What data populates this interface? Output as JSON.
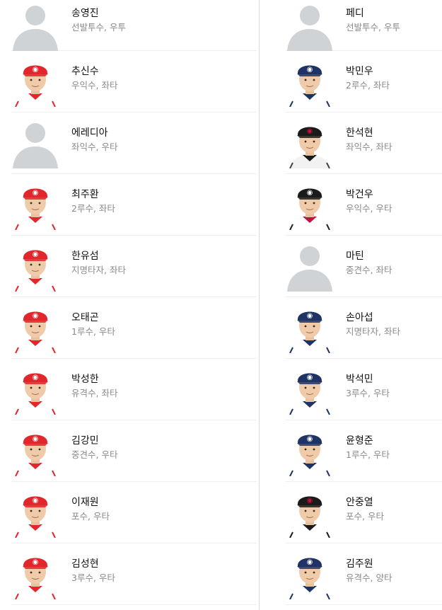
{
  "colors": {
    "ssg": "#e1262c",
    "nc": "#1f3464",
    "lg": "#c1123b",
    "kt": "#1b1b1b",
    "lotte": "#2a3556",
    "placeholder": "#cfd3d6"
  },
  "left_players": [
    {
      "name": "송영진",
      "detail": "선발투수, 우투",
      "photo": "placeholder-icon"
    },
    {
      "name": "추신수",
      "detail": "우익수, 좌타",
      "photo": "ssg-cap"
    },
    {
      "name": "에레디아",
      "detail": "좌익수, 우타",
      "photo": "placeholder-icon"
    },
    {
      "name": "최주환",
      "detail": "2루수, 좌타",
      "photo": "ssg-cap"
    },
    {
      "name": "한유섬",
      "detail": "지명타자, 좌타",
      "photo": "ssg-cap"
    },
    {
      "name": "오태곤",
      "detail": "1루수, 우타",
      "photo": "ssg-cap"
    },
    {
      "name": "박성한",
      "detail": "유격수, 좌타",
      "photo": "ssg-cap"
    },
    {
      "name": "김강민",
      "detail": "중견수, 우타",
      "photo": "ssg-cap"
    },
    {
      "name": "이재원",
      "detail": "포수, 우타",
      "photo": "ssg-cap"
    },
    {
      "name": "김성현",
      "detail": "3루수, 우타",
      "photo": "ssg-cap"
    }
  ],
  "right_players": [
    {
      "name": "페디",
      "detail": "선발투수, 우투",
      "photo": "placeholder-icon"
    },
    {
      "name": "박민우",
      "detail": "2루수, 좌타",
      "photo": "nc-cap"
    },
    {
      "name": "한석현",
      "detail": "좌익수, 좌타",
      "photo": "lg-cap"
    },
    {
      "name": "박건우",
      "detail": "우익수, 우타",
      "photo": "kt-cap"
    },
    {
      "name": "마틴",
      "detail": "중견수, 좌타",
      "photo": "placeholder-icon"
    },
    {
      "name": "손아섭",
      "detail": "지명타자, 좌타",
      "photo": "nc-cap"
    },
    {
      "name": "박석민",
      "detail": "3루수, 우타",
      "photo": "nc-cap"
    },
    {
      "name": "윤형준",
      "detail": "1루수, 우타",
      "photo": "nc-cap"
    },
    {
      "name": "안중열",
      "detail": "포수, 우타",
      "photo": "lotte-cap"
    },
    {
      "name": "김주원",
      "detail": "유격수, 양타",
      "photo": "nc-cap"
    }
  ]
}
